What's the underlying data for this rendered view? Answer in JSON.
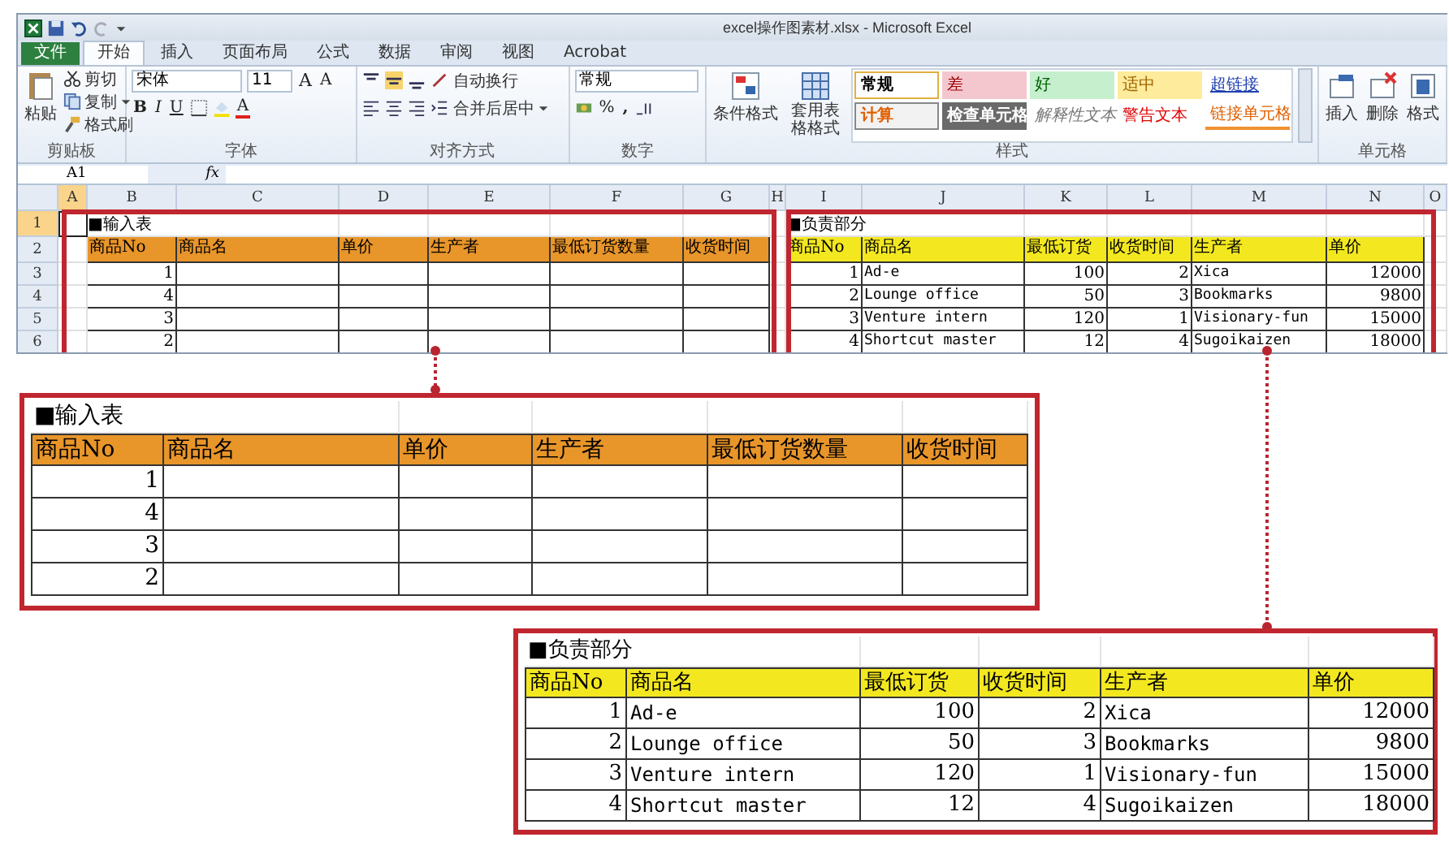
{
  "window": {
    "title": "excel操作图素材.xlsx - Microsoft Excel"
  },
  "tabs": [
    {
      "label": "文件",
      "kind": "backstage",
      "selected": false
    },
    {
      "label": "开始",
      "kind": "tab",
      "selected": true
    },
    {
      "label": "插入",
      "kind": "tab",
      "selected": false
    },
    {
      "label": "页面布局",
      "kind": "tab",
      "selected": false
    },
    {
      "label": "公式",
      "kind": "tab",
      "selected": false
    },
    {
      "label": "数据",
      "kind": "tab",
      "selected": false
    },
    {
      "label": "审阅",
      "kind": "tab",
      "selected": false
    },
    {
      "label": "视图",
      "kind": "tab",
      "selected": false
    },
    {
      "label": "Acrobat",
      "kind": "tab",
      "selected": false
    }
  ],
  "clipboard": {
    "label": "剪贴板",
    "paste": "粘贴",
    "cut": "剪切",
    "copy": "复制",
    "format_painter": "格式刷"
  },
  "font": {
    "label": "字体",
    "family": "宋体",
    "size": "11",
    "grow": "A",
    "shrink": "A",
    "bold": "B",
    "italic": "I",
    "underline": "U",
    "font_color": "A"
  },
  "alignment": {
    "label": "对齐方式",
    "wrap": "自动换行",
    "merge": "合并后居中"
  },
  "number": {
    "label": "数字",
    "format": "常规",
    "percent": "%",
    "comma": ","
  },
  "styles": {
    "label": "样式",
    "conditional": "条件格式",
    "table_format": "套用表格格式",
    "cells": [
      {
        "text": "常规",
        "kind": "normal"
      },
      {
        "text": "差",
        "kind": "bad"
      },
      {
        "text": "好",
        "kind": "good"
      },
      {
        "text": "适中",
        "kind": "neutral"
      },
      {
        "text": "超链接",
        "kind": "hyperlink"
      },
      {
        "text": "计算",
        "kind": "calculation"
      },
      {
        "text": "检查单元格",
        "kind": "check"
      },
      {
        "text": "解释性文本",
        "kind": "explanatory"
      },
      {
        "text": "警告文本",
        "kind": "warning"
      },
      {
        "text": "链接单元格",
        "kind": "linked"
      }
    ]
  },
  "cells_group": {
    "label": "单元格",
    "insert": "插入",
    "delete": "删除",
    "format": "格式"
  },
  "formula_bar": {
    "name_box": "A1",
    "function_label": "fx"
  },
  "sheet": {
    "columns": [
      {
        "label": "A",
        "selected": true
      },
      {
        "label": "B",
        "selected": false
      },
      {
        "label": "C",
        "selected": false
      },
      {
        "label": "D",
        "selected": false
      },
      {
        "label": "E",
        "selected": false
      },
      {
        "label": "F",
        "selected": false
      },
      {
        "label": "G",
        "selected": false
      },
      {
        "label": "H",
        "selected": false
      },
      {
        "label": "I",
        "selected": false
      },
      {
        "label": "J",
        "selected": false
      },
      {
        "label": "K",
        "selected": false
      },
      {
        "label": "L",
        "selected": false
      },
      {
        "label": "M",
        "selected": false
      },
      {
        "label": "N",
        "selected": false
      },
      {
        "label": "O",
        "selected": false
      }
    ],
    "rows": [
      {
        "label": "1",
        "selected": true
      },
      {
        "label": "2",
        "selected": false
      },
      {
        "label": "3",
        "selected": false
      },
      {
        "label": "4",
        "selected": false
      },
      {
        "label": "5",
        "selected": false
      },
      {
        "label": "6",
        "selected": false
      }
    ],
    "input_table": {
      "title": "■输入表",
      "headers": [
        "商品No",
        "商品名",
        "单价",
        "生产者",
        "最低订货数量",
        "收货时间"
      ],
      "rows": [
        {
          "no": "1"
        },
        {
          "no": "4"
        },
        {
          "no": "3"
        },
        {
          "no": "2"
        }
      ]
    },
    "owner_table": {
      "title": "■负责部分",
      "headers": [
        "商品No",
        "商品名",
        "最低订货",
        "收货时间",
        "生产者",
        "单价"
      ],
      "rows": [
        {
          "no": "1",
          "name": "Ad-e",
          "min_order": "100",
          "delivery": "2",
          "maker": "Xica",
          "price": "12000"
        },
        {
          "no": "2",
          "name": "Lounge office",
          "min_order": "50",
          "delivery": "3",
          "maker": "Bookmarks",
          "price": "9800"
        },
        {
          "no": "3",
          "name": "Venture intern",
          "min_order": "120",
          "delivery": "1",
          "maker": "Visionary-fun",
          "price": "15000"
        },
        {
          "no": "4",
          "name": "Shortcut master",
          "min_order": "12",
          "delivery": "4",
          "maker": "Sugoikaizen",
          "price": "18000"
        }
      ]
    }
  },
  "callout_input": {
    "title": "■输入表",
    "headers": [
      "商品No",
      "商品名",
      "单价",
      "生产者",
      "最低订货数量",
      "收货时间"
    ],
    "rows": [
      {
        "no": "1"
      },
      {
        "no": "4"
      },
      {
        "no": "3"
      },
      {
        "no": "2"
      }
    ]
  },
  "callout_owner": {
    "title": "■负责部分",
    "headers": [
      "商品No",
      "商品名",
      "最低订货",
      "收货时间",
      "生产者",
      "单价"
    ],
    "rows": [
      {
        "no": "1",
        "name": "Ad-e",
        "min_order": "100",
        "delivery": "2",
        "maker": "Xica",
        "price": "12000"
      },
      {
        "no": "2",
        "name": "Lounge office",
        "min_order": "50",
        "delivery": "3",
        "maker": "Bookmarks",
        "price": "9800"
      },
      {
        "no": "3",
        "name": "Venture intern",
        "min_order": "120",
        "delivery": "1",
        "maker": "Visionary-fun",
        "price": "15000"
      },
      {
        "no": "4",
        "name": "Shortcut master",
        "min_order": "12",
        "delivery": "4",
        "maker": "Sugoikaizen",
        "price": "18000"
      }
    ]
  }
}
